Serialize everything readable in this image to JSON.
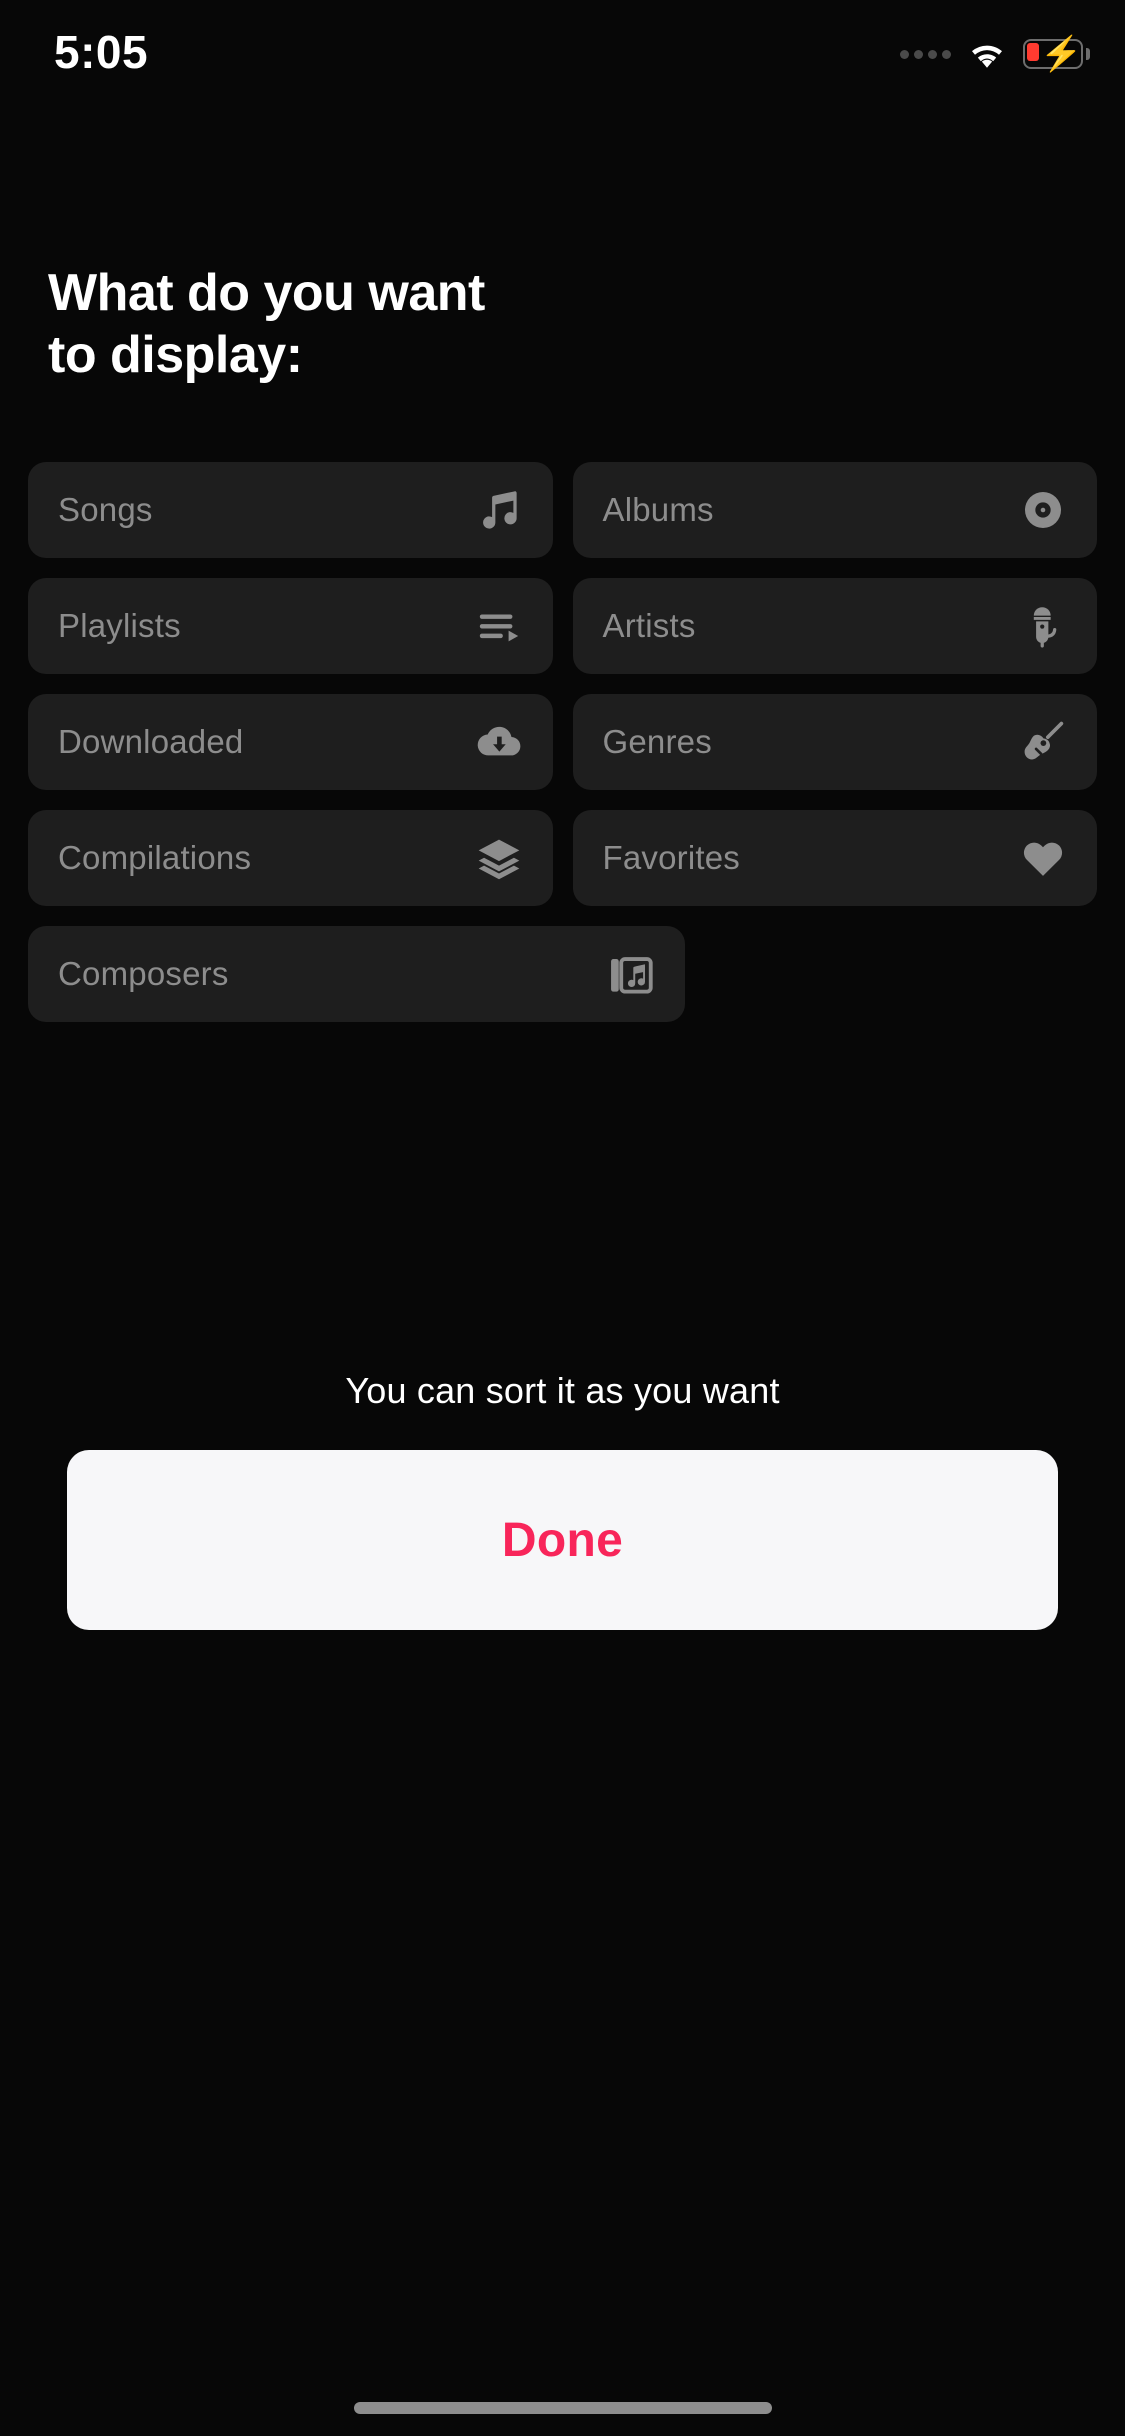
{
  "status_bar": {
    "time": "5:05",
    "signal_icon": "signal-dots-icon",
    "wifi_icon": "wifi-icon",
    "battery_icon": "battery-low-charging-icon",
    "battery_color": "#ff3b30"
  },
  "heading": {
    "line1": "What do you want",
    "line2": "to display:",
    "full": "What do you want\nto display:"
  },
  "options": {
    "rows": [
      [
        {
          "label": "Songs",
          "icon": "music-note-icon"
        },
        {
          "label": "Albums",
          "icon": "vinyl-disc-icon"
        }
      ],
      [
        {
          "label": "Playlists",
          "icon": "playlist-queue-icon"
        },
        {
          "label": "Artists",
          "icon": "microphone-icon"
        }
      ],
      [
        {
          "label": "Downloaded",
          "icon": "cloud-download-icon"
        },
        {
          "label": "Genres",
          "icon": "guitar-icon"
        }
      ],
      [
        {
          "label": "Compilations",
          "icon": "layers-stack-icon"
        },
        {
          "label": "Favorites",
          "icon": "heart-icon"
        }
      ],
      [
        {
          "label": "Composers",
          "icon": "music-library-icon"
        }
      ]
    ]
  },
  "footer": {
    "hint": "You can sort it as you want",
    "done_label": "Done",
    "done_text_color": "#f8255a",
    "done_bg_color": "#f7f7f9"
  },
  "theme": {
    "background": "#070707",
    "chip_background": "#1e1e1e",
    "chip_text": "#8d8d8d",
    "title_text": "#ffffff"
  },
  "home_indicator": "home-indicator"
}
